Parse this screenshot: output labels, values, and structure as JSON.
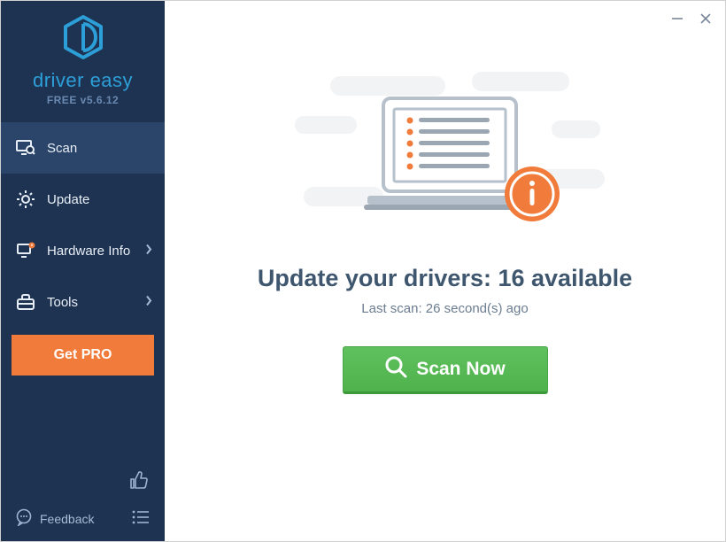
{
  "app": {
    "name": "driver easy",
    "version_label": "FREE v5.6.12"
  },
  "sidebar": {
    "items": [
      {
        "label": "Scan"
      },
      {
        "label": "Update"
      },
      {
        "label": "Hardware Info"
      },
      {
        "label": "Tools"
      }
    ],
    "get_pro": "Get PRO",
    "feedback": "Feedback"
  },
  "main": {
    "headline_prefix": "Update your drivers: ",
    "available_count": 16,
    "headline_suffix": " available",
    "last_scan": "Last scan: 26 second(s) ago",
    "scan_button": "Scan Now"
  },
  "colors": {
    "sidebar_bg": "#1e3352",
    "accent_orange": "#f07b3b",
    "scan_green": "#56b954",
    "brand_blue": "#2d9fd8"
  }
}
